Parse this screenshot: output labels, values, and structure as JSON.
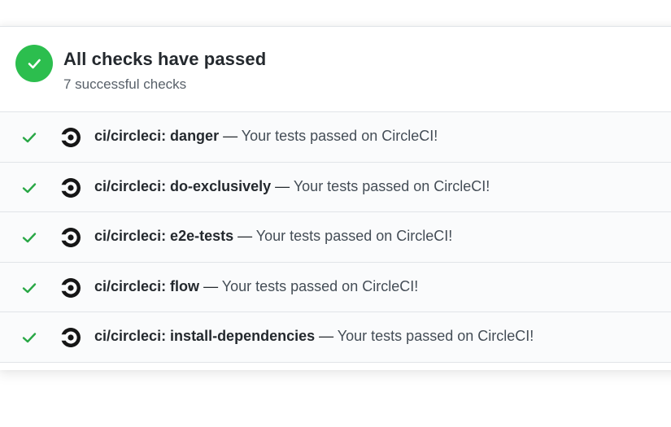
{
  "summary": {
    "title": "All checks have passed",
    "subtitle": "7 successful checks",
    "status_color": "#2cbe4e"
  },
  "checks": [
    {
      "name": "ci/circleci: danger",
      "separator": " — ",
      "description": "Your tests passed on CircleCI!",
      "status": "success",
      "icon": "circleci-logo-icon"
    },
    {
      "name": "ci/circleci: do-exclusively",
      "separator": " — ",
      "description": "Your tests passed on CircleCI!",
      "status": "success",
      "icon": "circleci-logo-icon"
    },
    {
      "name": "ci/circleci: e2e-tests",
      "separator": " — ",
      "description": "Your tests passed on CircleCI!",
      "status": "success",
      "icon": "circleci-logo-icon"
    },
    {
      "name": "ci/circleci: flow",
      "separator": " — ",
      "description": "Your tests passed on CircleCI!",
      "status": "success",
      "icon": "circleci-logo-icon"
    },
    {
      "name": "ci/circleci: install-dependencies",
      "separator": " — ",
      "description": "Your tests passed on CircleCI!",
      "status": "success",
      "icon": "circleci-logo-icon"
    }
  ],
  "colors": {
    "success_check": "#28a745",
    "logo": "#161616"
  }
}
